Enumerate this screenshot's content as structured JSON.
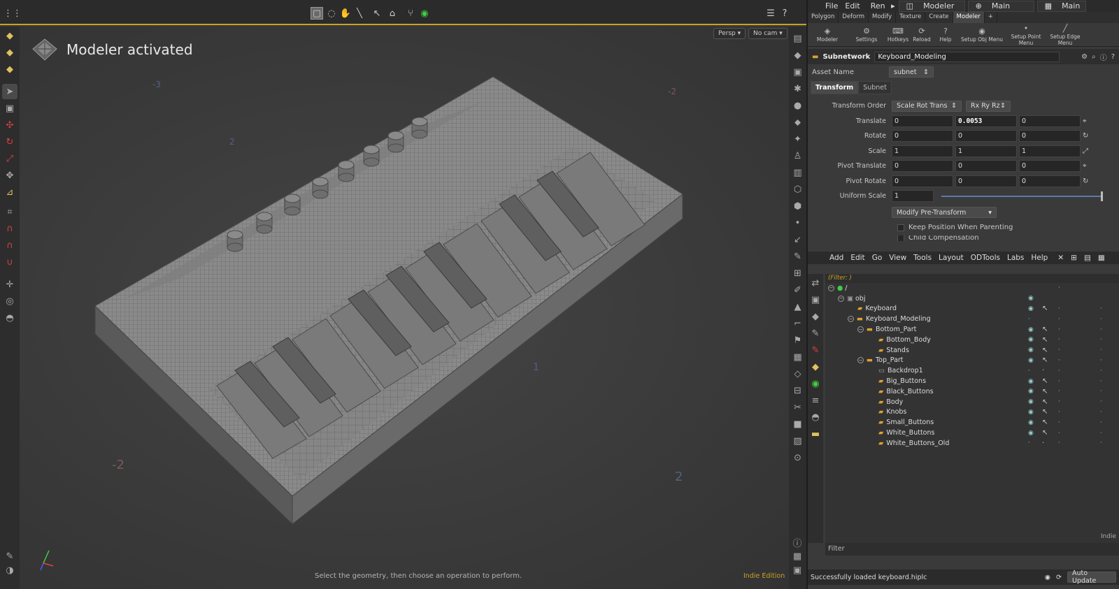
{
  "viewport": {
    "banner": "Modeler activated",
    "persp_label": "Persp",
    "cam_label": "No cam",
    "status": "Select the geometry, then choose an operation to perform.",
    "edition": "Indie Edition",
    "axis_labels": [
      "-2",
      "2",
      "1",
      "2",
      "-3",
      "-2",
      "2"
    ]
  },
  "menu": {
    "items": [
      "File",
      "Edit",
      "Ren"
    ],
    "desktop": "Modeler",
    "main1": "Main",
    "main2": "Main"
  },
  "shelf_tabs": [
    "Polygon",
    "Deform",
    "Modify",
    "Texture",
    "Create",
    "Modeler"
  ],
  "shelf_buttons": [
    "Modeler",
    "Settings",
    "Hotkeys",
    "Reload",
    "Help",
    "Setup Obj Menu",
    "Setup Point Menu",
    "Setup Edge Menu"
  ],
  "params": {
    "type_label": "Subnetwork",
    "node_name": "Keyboard_Modeling",
    "asset_name_label": "Asset Name",
    "asset_name_value": "subnet",
    "tabs": [
      "Transform",
      "Subnet"
    ],
    "transform_order_label": "Transform Order",
    "transform_order_value": "Scale Rot Trans",
    "rot_order_value": "Rx Ry Rz",
    "translate": {
      "label": "Translate",
      "x": "0",
      "y": "0.0053",
      "z": "0"
    },
    "rotate": {
      "label": "Rotate",
      "x": "0",
      "y": "0",
      "z": "0"
    },
    "scale": {
      "label": "Scale",
      "x": "1",
      "y": "1",
      "z": "1"
    },
    "pivot_translate": {
      "label": "Pivot Translate",
      "x": "0",
      "y": "0",
      "z": "0"
    },
    "pivot_rotate": {
      "label": "Pivot Rotate",
      "x": "0",
      "y": "0",
      "z": "0"
    },
    "uniform_scale": {
      "label": "Uniform Scale",
      "value": "1"
    },
    "modify_pretransform": "Modify Pre-Transform",
    "keep_position": "Keep Position When Parenting",
    "child_comp": "Child Compensation"
  },
  "network_menu": [
    "Add",
    "Edit",
    "Go",
    "View",
    "Tools",
    "Layout",
    "ODTools",
    "Labs",
    "Help"
  ],
  "tree": {
    "filter": "(Filter: )",
    "root": "/",
    "obj": "obj",
    "keyboard": "Keyboard",
    "keyboard_modeling": "Keyboard_Modeling",
    "bottom_part": "Bottom_Part",
    "bottom_body": "Bottom_Body",
    "stands": "Stands",
    "top_part": "Top_Part",
    "backdrop1": "Backdrop1",
    "big_buttons": "Big_Buttons",
    "black_buttons": "Black_Buttons",
    "body": "Body",
    "knobs": "Knobs",
    "small_buttons": "Small_Buttons",
    "white_buttons": "White_Buttons",
    "white_buttons_old": "White_Buttons_Old",
    "indie": "Indie",
    "filter_label": "Filter"
  },
  "status": {
    "message": "Successfully loaded keyboard.hiplc",
    "auto_update": "Auto Update"
  }
}
